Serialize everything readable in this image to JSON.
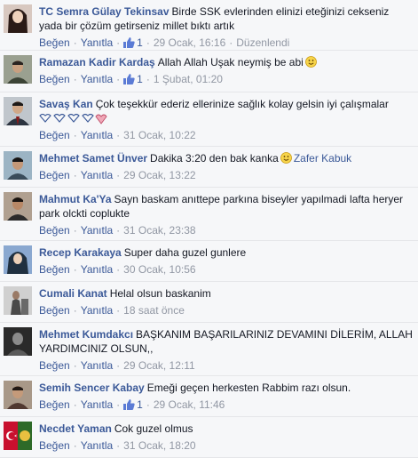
{
  "labels": {
    "like": "Beğen",
    "reply": "Yanıtla",
    "dot": "·"
  },
  "colors": {
    "link": "#3b5998",
    "meta": "#9197a3",
    "background": "#f6f7f9"
  },
  "comments": [
    {
      "author": "TC Semra Gülay Tekinsav",
      "text": "Birde SSK evlerinden elinizi eteğinizi cekseniz yada bir çözüm getirseniz millet bıktı artık",
      "likes": "1",
      "time": "29 Ocak, 16:16",
      "edited": "Düzenlendi",
      "avatar_color": "#3a3030"
    },
    {
      "author": "Ramazan Kadir Kardaş",
      "text": "Allah Allah Uşak neymiş be abi",
      "emoji": "smile-emoji",
      "likes": "1",
      "time": "1 Şubat, 01:20",
      "avatar_color": "#6a7060"
    },
    {
      "author": "Savaş Kan",
      "text": "Çok teşekkür ederiz ellerinize sağlık kolay gelsin iyi çalışmalar",
      "hearts_icon": "heart-emoticons",
      "time": "31 Ocak, 10:22",
      "avatar_color": "#5c6470"
    },
    {
      "author": "Mehmet Samet Ünver",
      "text": "Dakika 3:20 den bak kanka",
      "emoji": "smile-emoji",
      "mention": "Zafer Kabuk",
      "time": "29 Ocak, 13:22",
      "avatar_color": "#4e6a7c"
    },
    {
      "author": "Mahmut Ka'Ya",
      "text": "Sayn baskam anıttepe parkına biseyler yapılmadi lafta heryer park olckti coplukte",
      "time": "31 Ocak, 23:38",
      "avatar_color": "#5a4a40"
    },
    {
      "author": "Recep Karakaya",
      "text": "Super daha guzel gunlere",
      "time": "30 Ocak, 10:56",
      "avatar_color": "#7890b0"
    },
    {
      "author": "Cumali Kanat",
      "text": "Helal olsun baskanim",
      "time": "18 saat önce",
      "avatar_color": "#6a6a6a"
    },
    {
      "author": "Mehmet Kumdakcı",
      "text": "BAŞKANIM BAŞARILARINIZ DEVAMINI DİLERİM, ALLAH YARDIMCINIZ OLSUN,,",
      "time": "29 Ocak, 12:11",
      "avatar_color": "#404040"
    },
    {
      "author": "Semih Sencer Kabay",
      "text": "Emeği geçen herkesten Rabbim razı olsun.",
      "likes": "1",
      "time": "29 Ocak, 11:46",
      "avatar_color": "#705850"
    },
    {
      "author": "Necdet Yaman",
      "text": "Cok guzel olmus",
      "time": "31 Ocak, 18:20",
      "avatar_color": "#3a6a30"
    }
  ]
}
